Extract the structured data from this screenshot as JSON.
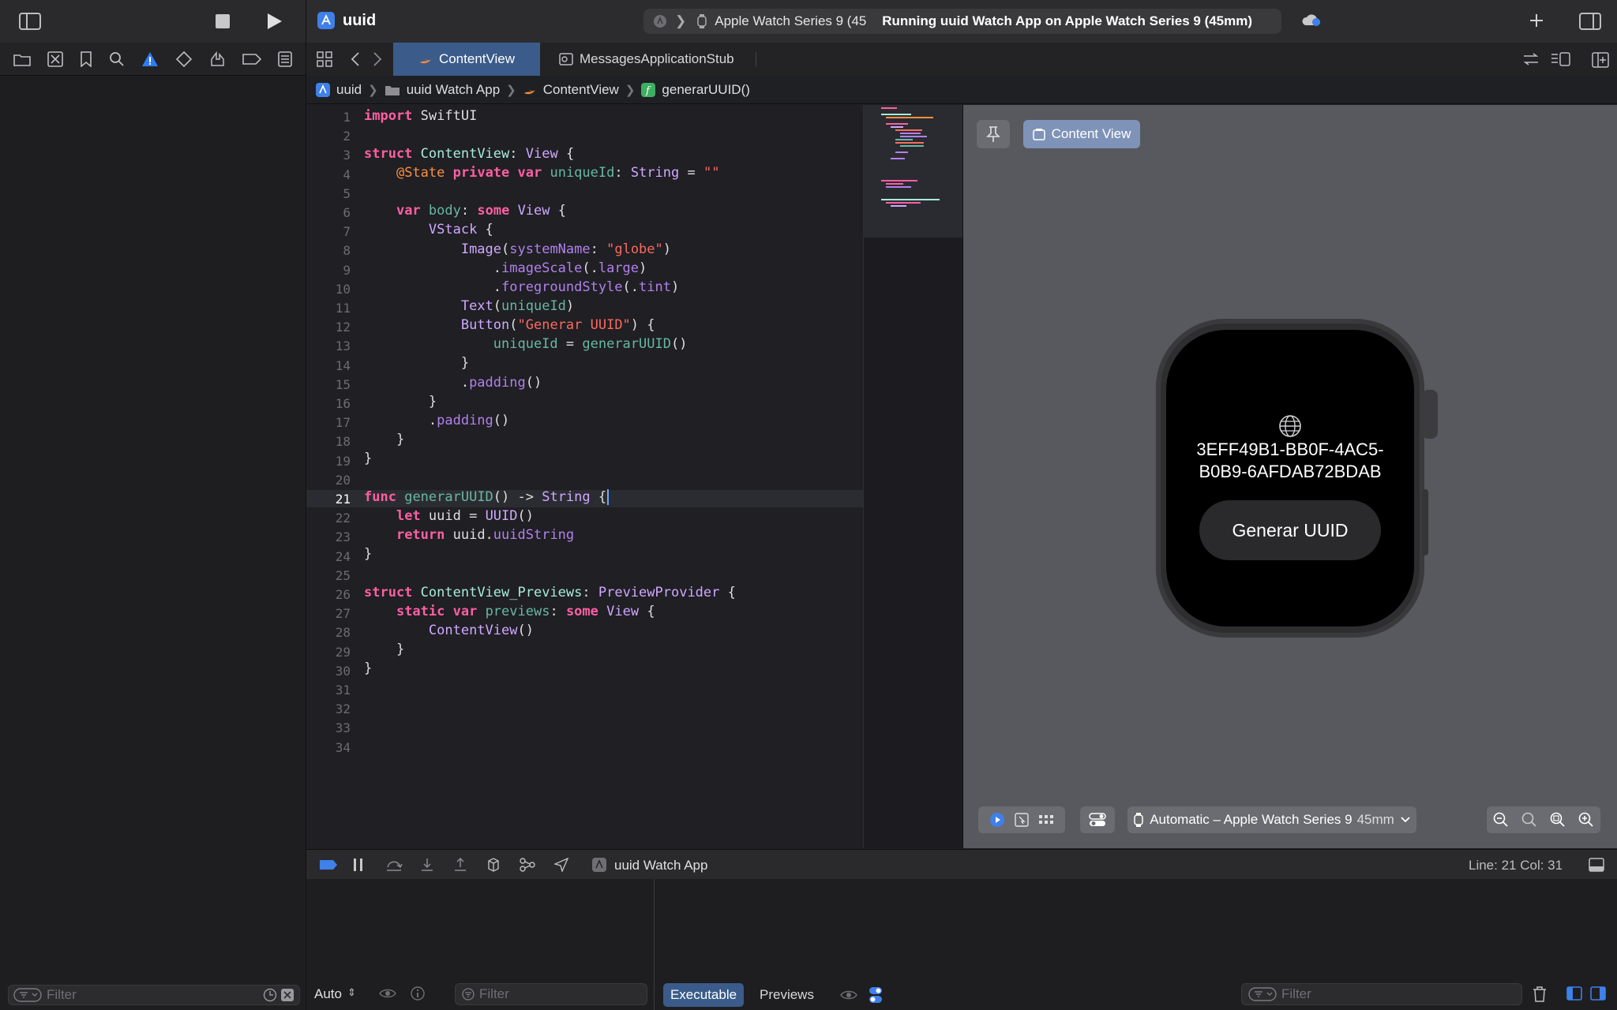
{
  "project": {
    "name": "uuid"
  },
  "activity": {
    "scheme_device": "Apple Watch Series 9 (45",
    "status": "Running uuid Watch App on Apple Watch Series 9 (45mm)"
  },
  "tabs": [
    {
      "label": "ContentView",
      "active": true
    },
    {
      "label": "MessagesApplicationStub",
      "active": false
    }
  ],
  "breadcrumb": [
    "uuid",
    "uuid Watch App",
    "ContentView",
    "generarUUID()"
  ],
  "editor": {
    "line_numbers": [
      "1",
      "2",
      "3",
      "4",
      "5",
      "6",
      "7",
      "8",
      "9",
      "10",
      "11",
      "12",
      "13",
      "14",
      "15",
      "16",
      "17",
      "18",
      "19",
      "20",
      "21",
      "22",
      "23",
      "24",
      "25",
      "26",
      "27",
      "28",
      "29",
      "30",
      "31",
      "32",
      "33",
      "34"
    ],
    "current_line": 21
  },
  "preview": {
    "chip_label": "Content View",
    "uuid_line1": "3EFF49B1-BB0F-4AC5-",
    "uuid_line2": "B0B9-6AFDAB72BDAB",
    "button_label": "Generar UUID",
    "device_label": "Automatic – Apple Watch Series 9",
    "device_size": "45mm"
  },
  "debug": {
    "target": "uuid Watch App",
    "position": "Line: 21  Col: 31",
    "auto_label": "Auto",
    "filter_placeholder": "Filter",
    "executable_tab": "Executable",
    "previews_tab": "Previews"
  },
  "navigator": {
    "filter_placeholder": "Filter"
  },
  "colors": {
    "accent": "#3b5c8a",
    "warning": "#2f7cf6"
  }
}
